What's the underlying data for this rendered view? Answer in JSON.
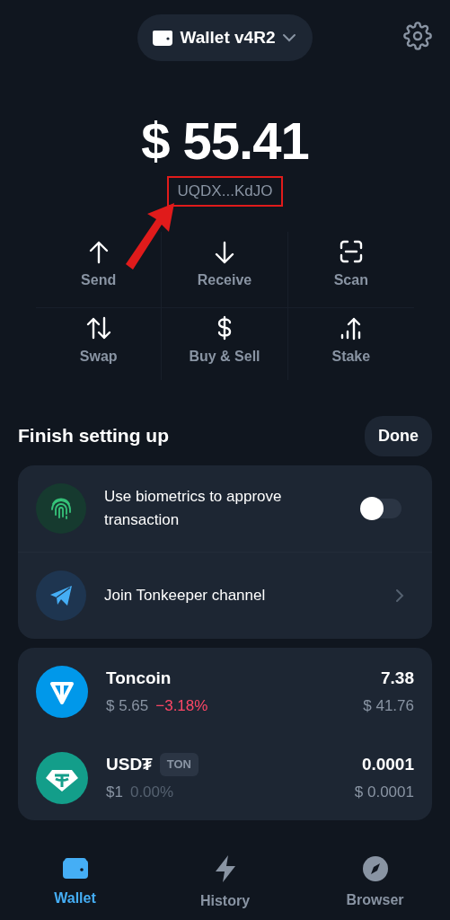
{
  "header": {
    "wallet_name": "Wallet v4R2"
  },
  "balance": {
    "amount": "$ 55.41",
    "address": "UQDX...KdJO",
    "highlighted": true
  },
  "actions": [
    {
      "kind": "send",
      "label": "Send"
    },
    {
      "kind": "receive",
      "label": "Receive"
    },
    {
      "kind": "scan",
      "label": "Scan"
    },
    {
      "kind": "swap",
      "label": "Swap"
    },
    {
      "kind": "buy",
      "label": "Buy & Sell"
    },
    {
      "kind": "stake",
      "label": "Stake"
    }
  ],
  "setup": {
    "title": "Finish setting up",
    "done_label": "Done",
    "items": [
      {
        "kind": "toggle",
        "text": "Use biometrics to approve transaction",
        "on": false
      },
      {
        "kind": "link",
        "text": "Join Tonkeeper channel"
      }
    ]
  },
  "tokens": [
    {
      "kind": "falling",
      "name": "Toncoin",
      "price": "$ 5.65",
      "change": "−3.18%",
      "amount": "7.38",
      "value": "$ 41.76"
    },
    {
      "kind": "flat",
      "name": "USD₮",
      "tag": "TON",
      "price": "$1",
      "change": "0.00%",
      "amount": "0.0001",
      "value": "$ 0.0001"
    }
  ],
  "nav": [
    {
      "kind": "wallet",
      "label": "Wallet",
      "selected": true
    },
    {
      "kind": "history",
      "label": "History",
      "selected": false
    },
    {
      "kind": "browser",
      "label": "Browser",
      "selected": false
    }
  ]
}
